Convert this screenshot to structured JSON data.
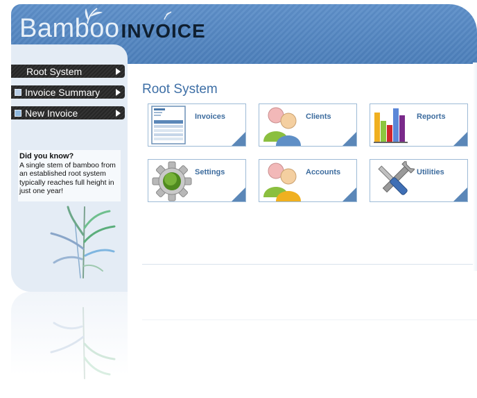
{
  "brand": {
    "name_part1": "Bamboo",
    "name_part2": "INVOICE",
    "header_color": "#4e82bf"
  },
  "sidebar": {
    "items": [
      {
        "label": "Root System",
        "icon": "none"
      },
      {
        "label": "Invoice Summary",
        "icon": "summary-icon"
      },
      {
        "label": "New Invoice",
        "icon": "new-invoice-icon"
      }
    ],
    "tip": {
      "title": "Did you know?",
      "text": "A single stem of bamboo from an established root system typically reaches full height in just one year!"
    }
  },
  "main": {
    "title": "Root System",
    "tiles": [
      {
        "label": "Invoices",
        "icon": "invoice-document-icon"
      },
      {
        "label": "Clients",
        "icon": "clients-icon"
      },
      {
        "label": "Reports",
        "icon": "bar-chart-icon"
      },
      {
        "label": "Settings",
        "icon": "gear-icon"
      },
      {
        "label": "Accounts",
        "icon": "accounts-icon"
      },
      {
        "label": "Utilities",
        "icon": "tools-icon"
      }
    ]
  }
}
